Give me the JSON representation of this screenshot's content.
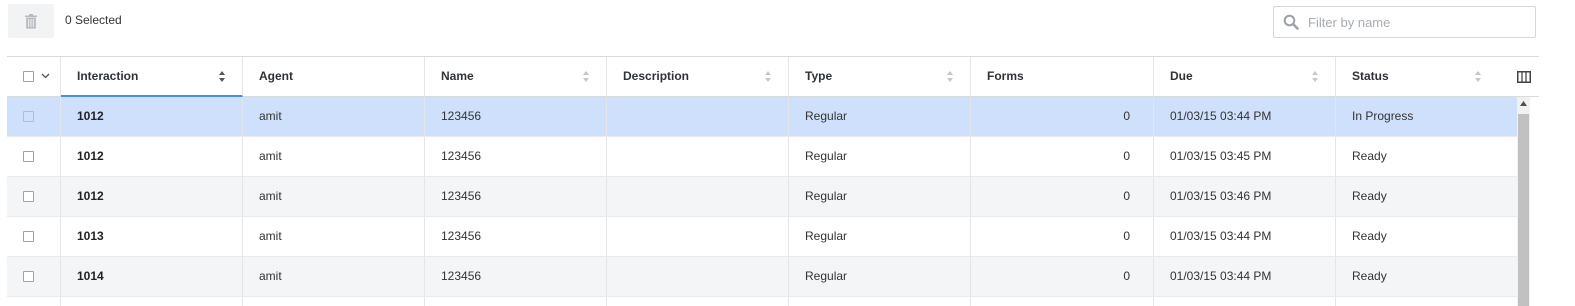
{
  "toolbar": {
    "delete_icon": "trash-icon",
    "selected_text": "0 Selected",
    "search": {
      "placeholder": "Filter by name",
      "value": "",
      "icon": "search-icon"
    }
  },
  "table": {
    "columns": [
      {
        "label": "Interaction",
        "sortable": true,
        "sorted": true
      },
      {
        "label": "Agent",
        "sortable": false
      },
      {
        "label": "Name",
        "sortable": true
      },
      {
        "label": "Description",
        "sortable": true
      },
      {
        "label": "Type",
        "sortable": true
      },
      {
        "label": "Forms",
        "sortable": false
      },
      {
        "label": "Due",
        "sortable": true
      },
      {
        "label": "Status",
        "sortable": true
      }
    ],
    "rows": [
      {
        "interaction": "1012",
        "agent": "amit",
        "name": "123456",
        "description": "",
        "type": "Regular",
        "forms": "0",
        "due": "01/03/15 03:44 PM",
        "status": "In Progress",
        "selected": true
      },
      {
        "interaction": "1012",
        "agent": "amit",
        "name": "123456",
        "description": "",
        "type": "Regular",
        "forms": "0",
        "due": "01/03/15 03:45 PM",
        "status": "Ready"
      },
      {
        "interaction": "1012",
        "agent": "amit",
        "name": "123456",
        "description": "",
        "type": "Regular",
        "forms": "0",
        "due": "01/03/15 03:46 PM",
        "status": "Ready"
      },
      {
        "interaction": "1013",
        "agent": "amit",
        "name": "123456",
        "description": "",
        "type": "Regular",
        "forms": "0",
        "due": "01/03/15 03:44 PM",
        "status": "Ready"
      },
      {
        "interaction": "1014",
        "agent": "amit",
        "name": "123456",
        "description": "",
        "type": "Regular",
        "forms": "0",
        "due": "01/03/15 03:44 PM",
        "status": "Ready"
      }
    ]
  },
  "colors": {
    "selected_row": "#cfe0fc",
    "accent": "#4a8fd9",
    "striped_row": "#f4f5f6"
  }
}
